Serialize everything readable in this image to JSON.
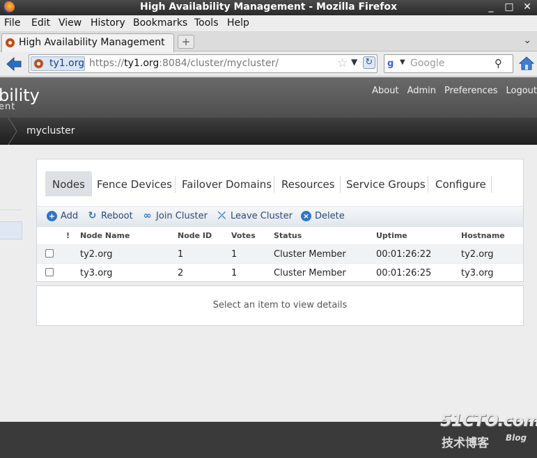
{
  "window": {
    "title": "High Availability Management - Mozilla Firefox",
    "controls": [
      "_",
      "□",
      "✕"
    ]
  },
  "menu": [
    {
      "label": "File"
    },
    {
      "label": "Edit"
    },
    {
      "label": "View"
    },
    {
      "label": "History"
    },
    {
      "label": "Bookmarks"
    },
    {
      "label": "Tools"
    },
    {
      "label": "Help"
    }
  ],
  "browser_tab": {
    "label": "High Availability Management",
    "new_tab": "+",
    "list_arrow": "⌄"
  },
  "address": {
    "site_identity": "ty1.org",
    "url_prefix": "https://",
    "url_host": "ty1.org",
    "url_rest": ":8084/cluster/mycluster/",
    "search_placeholder": "Google",
    "search_engine_letter": "g"
  },
  "app": {
    "brand_main": "bility",
    "brand_sub": "ent",
    "links": [
      "About",
      "Admin",
      "Preferences",
      "Logout"
    ],
    "breadcrumb_current": "mycluster"
  },
  "tabs": [
    {
      "label": "Nodes"
    },
    {
      "label": "Fence Devices"
    },
    {
      "label": "Failover Domains"
    },
    {
      "label": "Resources"
    },
    {
      "label": "Service Groups"
    },
    {
      "label": "Configure"
    }
  ],
  "toolbar": {
    "add": "Add",
    "reboot": "Reboot",
    "join": "Join Cluster",
    "leave": "Leave Cluster",
    "delete": "Delete"
  },
  "table": {
    "columns": {
      "flag": "!",
      "name": "Node Name",
      "id": "Node ID",
      "votes": "Votes",
      "status": "Status",
      "uptime": "Uptime",
      "hostname": "Hostname"
    },
    "rows": [
      {
        "name": "ty2.org",
        "id": "1",
        "votes": "1",
        "status": "Cluster Member",
        "uptime": "00:01:26:22",
        "hostname": "ty2.org"
      },
      {
        "name": "ty3.org",
        "id": "2",
        "votes": "1",
        "status": "Cluster Member",
        "uptime": "00:01:26:25",
        "hostname": "ty3.org"
      }
    ]
  },
  "details_message": "Select an item to view details",
  "watermark": {
    "line1": "51CTO.com",
    "line2": "技术博客",
    "line3": "Blog"
  },
  "colors": {
    "accent_blue": "#2e6bc4",
    "header_gray": "#5a5a5a",
    "footer": "#3a3a3a"
  }
}
